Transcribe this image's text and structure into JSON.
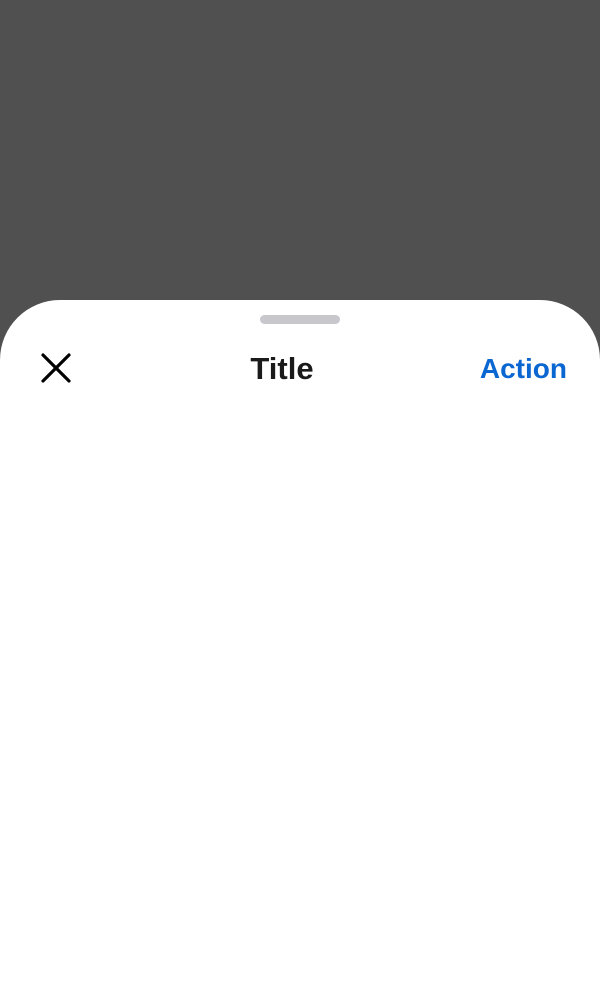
{
  "sheet": {
    "title": "Title",
    "close_icon": "close-icon",
    "action_label": "Action"
  },
  "colors": {
    "backdrop": "#505050",
    "sheet_background": "#ffffff",
    "title_text": "#1a1a1a",
    "action_text": "#0a66d1",
    "grabber": "#c7c7cc"
  }
}
